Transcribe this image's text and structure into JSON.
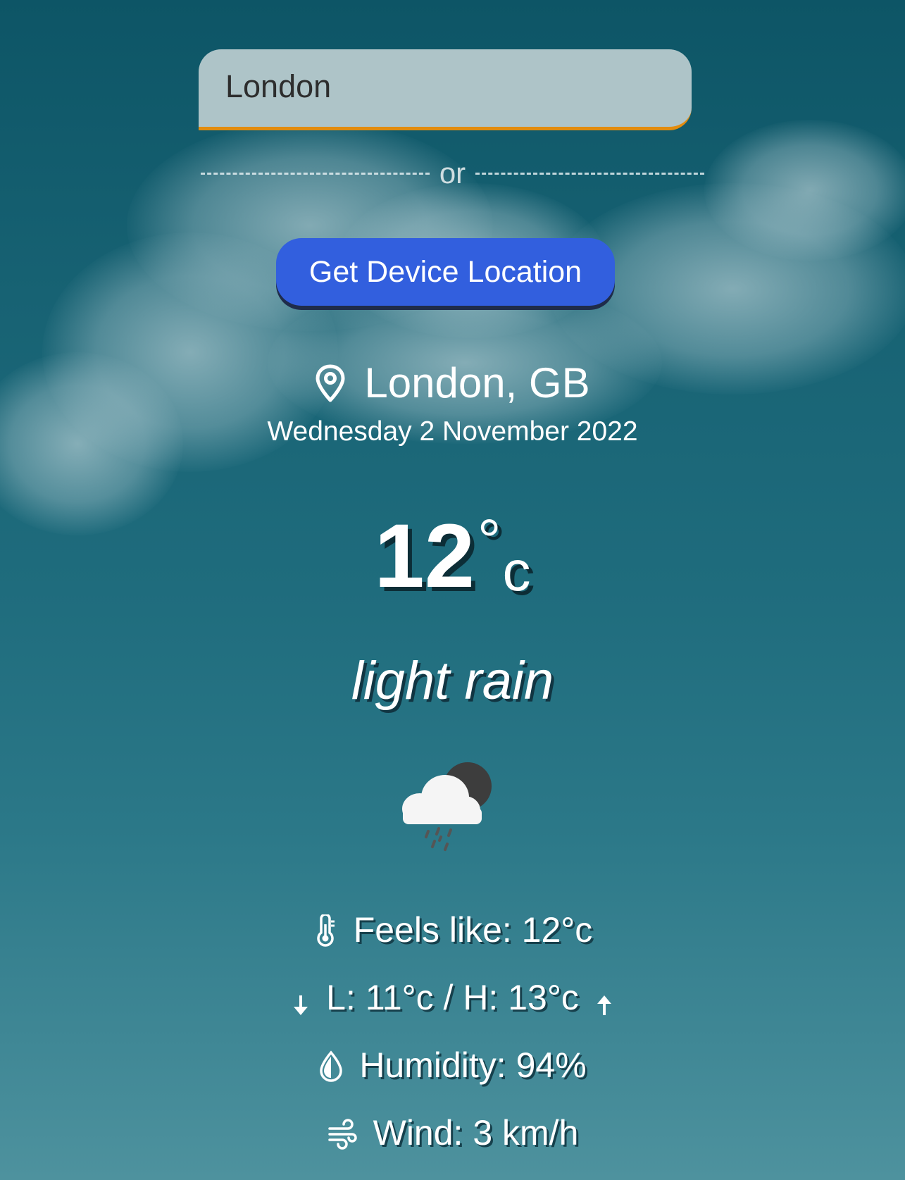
{
  "search": {
    "value": "London"
  },
  "divider": {
    "text": "or"
  },
  "device_location_button": {
    "label": "Get Device Location"
  },
  "location": {
    "name": "London, GB",
    "date": "Wednesday 2 November 2022",
    "icon": "map-pin-icon"
  },
  "current": {
    "temperature": "12",
    "degree_symbol": "°",
    "unit": "c",
    "description": "light rain",
    "icon": "cloud-rain-night-icon"
  },
  "details": {
    "feels_like": "Feels like: 12°c",
    "low_high_low": "L: 11°c",
    "low_high_separator": " / ",
    "low_high_high": "H: 13°c",
    "humidity": "Humidity: 94%",
    "wind": "Wind: 3 km/h"
  },
  "colors": {
    "accent_border": "#e28c0e",
    "button_blue": "#325fde",
    "background_top": "#0d5566",
    "background_bottom": "#4e929e"
  }
}
